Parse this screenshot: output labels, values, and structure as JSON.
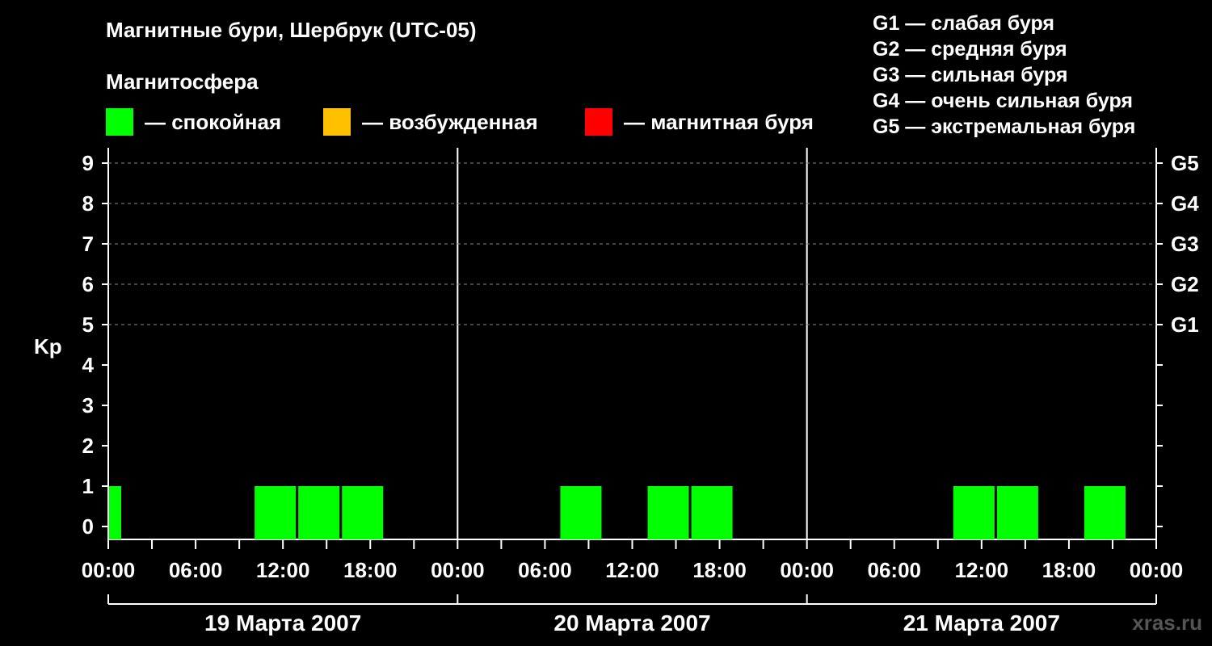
{
  "header": {
    "title": "Магнитные бури, Шербрук (UTC-05)",
    "subtitle": "Магнитосфера"
  },
  "legend": [
    {
      "label": "— спокойная",
      "color": "#00ff00"
    },
    {
      "label": "— возбужденная",
      "color": "#ffc000"
    },
    {
      "label": "— магнитная буря",
      "color": "#ff0000"
    }
  ],
  "g_legend": [
    "G1 — слабая буря",
    "G2 — средняя буря",
    "G3 — сильная буря",
    "G4 — очень сильная буря",
    "G5 — экстремальная буря"
  ],
  "watermark": "xras.ru",
  "chart_data": {
    "type": "bar",
    "ylabel": "Kp",
    "ylim": [
      0,
      9
    ],
    "yticks": [
      0,
      1,
      2,
      3,
      4,
      5,
      6,
      7,
      8,
      9
    ],
    "right_axis_labels": [
      {
        "kp": 5,
        "label": "G1"
      },
      {
        "kp": 6,
        "label": "G2"
      },
      {
        "kp": 7,
        "label": "G3"
      },
      {
        "kp": 8,
        "label": "G4"
      },
      {
        "kp": 9,
        "label": "G5"
      }
    ],
    "x_tick_labels": [
      "00:00",
      "06:00",
      "12:00",
      "18:00",
      "00:00",
      "06:00",
      "12:00",
      "18:00",
      "00:00",
      "06:00",
      "12:00",
      "18:00",
      "00:00"
    ],
    "days": [
      "19 Марта 2007",
      "20 Марта 2007",
      "21 Марта 2007"
    ],
    "grid": "dashed horizontal at Kp 5-9",
    "bars": [
      {
        "day": 0,
        "start_hour": 0,
        "end_hour": 1,
        "kp": 1,
        "color": "#00ff00"
      },
      {
        "day": 0,
        "start_hour": 10,
        "end_hour": 13,
        "kp": 1,
        "color": "#00ff00"
      },
      {
        "day": 0,
        "start_hour": 13,
        "end_hour": 16,
        "kp": 1,
        "color": "#00ff00"
      },
      {
        "day": 0,
        "start_hour": 16,
        "end_hour": 19,
        "kp": 1,
        "color": "#00ff00"
      },
      {
        "day": 1,
        "start_hour": 7,
        "end_hour": 10,
        "kp": 1,
        "color": "#00ff00"
      },
      {
        "day": 1,
        "start_hour": 13,
        "end_hour": 16,
        "kp": 1,
        "color": "#00ff00"
      },
      {
        "day": 1,
        "start_hour": 16,
        "end_hour": 19,
        "kp": 1,
        "color": "#00ff00"
      },
      {
        "day": 2,
        "start_hour": 10,
        "end_hour": 13,
        "kp": 1,
        "color": "#00ff00"
      },
      {
        "day": 2,
        "start_hour": 13,
        "end_hour": 16,
        "kp": 1,
        "color": "#00ff00"
      },
      {
        "day": 2,
        "start_hour": 19,
        "end_hour": 22,
        "kp": 1,
        "color": "#00ff00"
      }
    ]
  }
}
